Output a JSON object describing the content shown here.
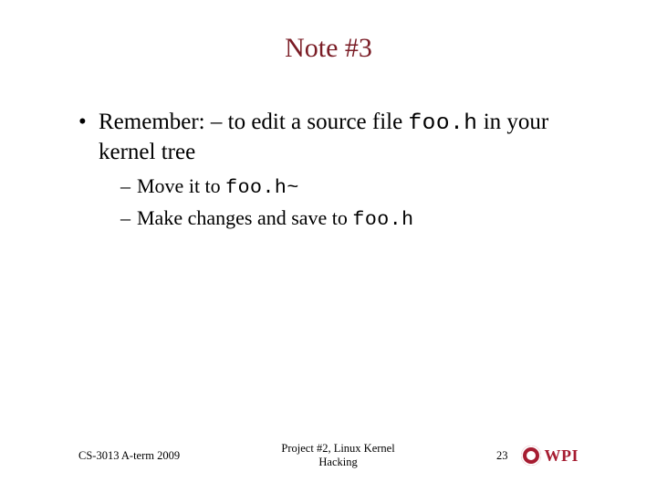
{
  "title": "Note #3",
  "bullets": [
    {
      "pre": "Remember: – to edit a source file ",
      "code": "foo.h",
      "post": " in your kernel tree",
      "sub": [
        {
          "pre": "Move it to ",
          "code": "foo.h~",
          "post": ""
        },
        {
          "pre": "Make changes and save to ",
          "code": "foo.h",
          "post": ""
        }
      ]
    }
  ],
  "footer": {
    "left": "CS-3013 A-term 2009",
    "center_line1": "Project #2, Linux Kernel",
    "center_line2": "Hacking",
    "page": "23",
    "logo_text": "WPI"
  }
}
